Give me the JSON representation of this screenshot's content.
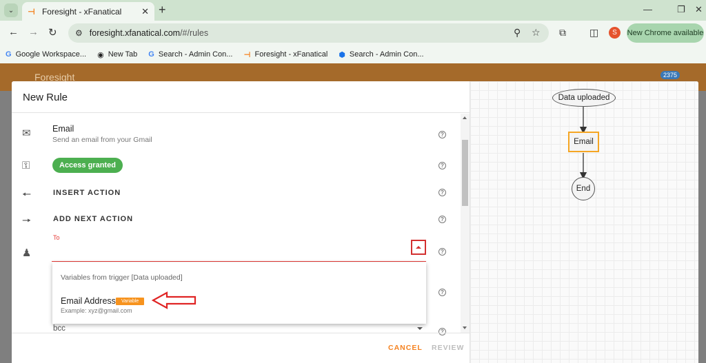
{
  "browser": {
    "tab_title": "Foresight - xFanatical",
    "address": "foresight.xfanatical.com",
    "address_path": "/#/rules",
    "profile_initial": "S",
    "update_button": "New Chrome available",
    "bookmarks": [
      {
        "label": "Google Workspace...",
        "icon": "google-icon"
      },
      {
        "label": "New Tab",
        "icon": "globe-icon"
      },
      {
        "label": "Search - Admin Con...",
        "icon": "google-icon"
      },
      {
        "label": "Foresight - xFanatical",
        "icon": "foresight-icon"
      },
      {
        "label": "Search - Admin Con...",
        "icon": "admin-icon"
      }
    ]
  },
  "app": {
    "title": "Foresight",
    "notification_count": "2375"
  },
  "modal": {
    "title": "New Rule",
    "email_action": {
      "title": "Email",
      "subtitle": "Send an email from your Gmail"
    },
    "access_label": "Access granted",
    "insert_action": "INSERT ACTION",
    "add_next_action": "ADD NEXT ACTION",
    "to_field": {
      "label": "To",
      "value": ""
    },
    "dropdown": {
      "header": "Variables from trigger [Data uploaded]",
      "item_label": "Email Address",
      "item_badge": "Variable",
      "item_example": "Example: xyz@gmail.com"
    },
    "bcc_label": "bcc",
    "cancel_label": "CANCEL",
    "review_label": "REVIEW"
  },
  "flow": {
    "start": "Data uploaded",
    "action": "Email",
    "end": "End"
  },
  "colors": {
    "accent": "#f58220",
    "success": "#4caf50",
    "error": "#e53935",
    "variable_badge": "#f7931e"
  }
}
